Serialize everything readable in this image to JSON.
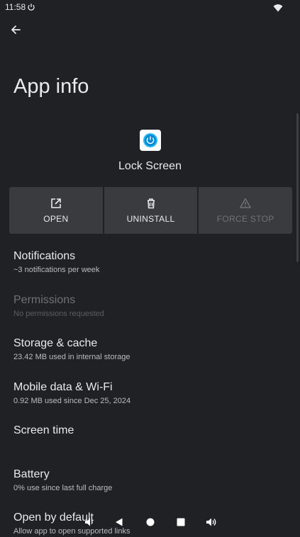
{
  "status": {
    "time": "11:58"
  },
  "page": {
    "title": "App info"
  },
  "app": {
    "name": "Lock Screen",
    "icon": "power-button-icon",
    "accent": "#29b6f6"
  },
  "actions": [
    {
      "label": "OPEN",
      "icon": "open-external-icon",
      "enabled": true
    },
    {
      "label": "UNINSTALL",
      "icon": "trash-icon",
      "enabled": true
    },
    {
      "label": "FORCE STOP",
      "icon": "warning-icon",
      "enabled": false
    }
  ],
  "items": [
    {
      "title": "Notifications",
      "subtitle": "~3 notifications per week",
      "enabled": true
    },
    {
      "title": "Permissions",
      "subtitle": "No permissions requested",
      "enabled": false
    },
    {
      "title": "Storage & cache",
      "subtitle": "23.42 MB used in internal storage",
      "enabled": true
    },
    {
      "title": "Mobile data & Wi-Fi",
      "subtitle": "0.92 MB used since Dec 25, 2024",
      "enabled": true
    },
    {
      "title": "Screen time",
      "subtitle": "",
      "enabled": true
    },
    {
      "title": "Battery",
      "subtitle": "0% use since last full charge",
      "enabled": true
    },
    {
      "title": "Open by default",
      "subtitle": "Allow app to open supported links",
      "enabled": true
    }
  ],
  "colors": {
    "background": "#202124",
    "surface": "#3a3b3e",
    "text": "#e8eaed",
    "disabled": "#6f7174"
  }
}
